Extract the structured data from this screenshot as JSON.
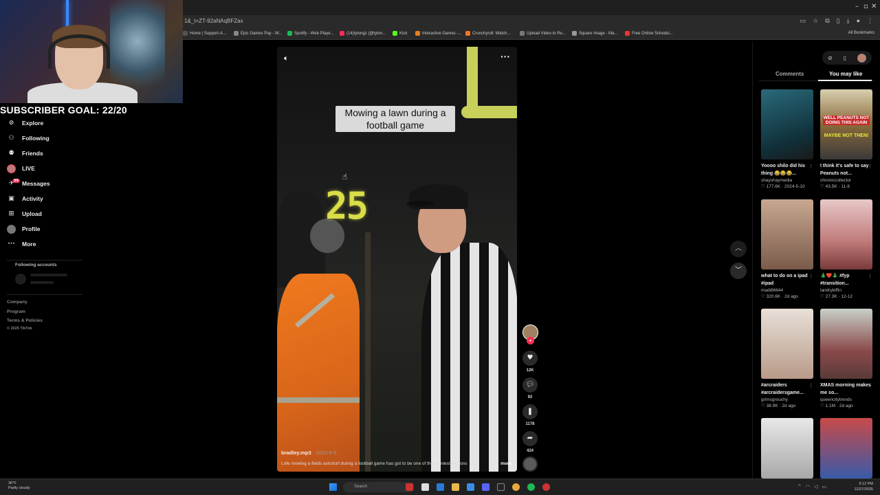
{
  "browser": {
    "url": "1&_t=ZT-92aNAqBFZax",
    "bookmarks": [
      {
        "label": "Home | Support-A...",
        "color": "#555"
      },
      {
        "label": "Epic Games Pay - W...",
        "color": "#888"
      },
      {
        "label": "Spotify - Web Playe...",
        "color": "#1db954"
      },
      {
        "label": "(14)tylongz (@tylon...",
        "color": "#fe2c55"
      },
      {
        "label": "Kick",
        "color": "#53fc18"
      },
      {
        "label": "Interactive Games -...",
        "color": "#e67e22"
      },
      {
        "label": "Crunchyroll: Watch...",
        "color": "#f47521"
      },
      {
        "label": "Upload Video to Re...",
        "color": "#777"
      },
      {
        "label": "Square Image - Ma...",
        "color": "#999"
      },
      {
        "label": "Free Online Schedul...",
        "color": "#e33"
      }
    ],
    "all_bookmarks": "All Bookmarks"
  },
  "overlay": {
    "subscriber_goal": "SUBSCRIBER GOAL: 22/20"
  },
  "nav": {
    "items": [
      {
        "label": "Explore",
        "icon": "compass-icon"
      },
      {
        "label": "Following",
        "icon": "person-icon"
      },
      {
        "label": "Friends",
        "icon": "friends-icon"
      },
      {
        "label": "LIVE",
        "icon": "live-avatar"
      },
      {
        "label": "Messages",
        "icon": "message-icon",
        "badge": "39"
      },
      {
        "label": "Activity",
        "icon": "inbox-icon"
      },
      {
        "label": "Upload",
        "icon": "plus-square-icon"
      },
      {
        "label": "Profile",
        "icon": "profile-avatar"
      },
      {
        "label": "More",
        "icon": "more-icon"
      }
    ],
    "following_accounts": "Following accounts",
    "footer": [
      "Company",
      "Program",
      "Terms & Policies",
      "© 2025 TikTok"
    ]
  },
  "video": {
    "caption": "Mowing a lawn during a football game",
    "clock_number": "25",
    "author": "bradley.mp3",
    "date": "· 2023-9-5",
    "description": "Lofe mowing a fields astroturf during a football game has got to be one of the funniest reasons",
    "more": "more"
  },
  "actions": {
    "likes": "12K",
    "comments": "92",
    "saves": "1178",
    "shares": "424"
  },
  "panel": {
    "tabs": [
      "Comments",
      "You may like"
    ],
    "active_tab": "You may like",
    "cards": [
      {
        "title": "Yoooo shilo did his thing 😂😂😂...",
        "user": "shayshaymedia",
        "likes": "177.6K",
        "date": "2024-5-10",
        "thumb_text": "",
        "bg": "linear-gradient(160deg,#2a6a7a,#10303a 70%,#1a1a1a)"
      },
      {
        "title": "I think it's safe to say Peanuts not...",
        "user": "chroniccollector",
        "likes": "43.5K",
        "date": "11-8",
        "thumb_text": "WELL PEANUTS NOT DOING THIS AGAIN",
        "thumb_text2": "MAYBE NOT THEN!",
        "bg": "linear-gradient(180deg,#d8d0b0,#8a6a3a 50%,#3a3a3a)"
      },
      {
        "title": "what to do on a ipad #ipad",
        "user": "madi86644",
        "likes": "320.6K",
        "date": "2d ago",
        "thumb_text": "",
        "bg": "linear-gradient(180deg,#c8a890,#7a5a4a)"
      },
      {
        "title": "🎄❤️🎄 #fyp #transition...",
        "user": "landrykiffin",
        "likes": "27.3K",
        "date": "12-12",
        "thumb_text": "",
        "bg": "linear-gradient(180deg,#e8c8c8,#c07a7a 60%,#7a3a3a)"
      },
      {
        "title": "#arcraiders #arcraidersgame...",
        "user": "grimsgrouchy",
        "likes": "38.9K",
        "date": "2d ago",
        "thumb_text": "",
        "bg": "linear-gradient(180deg,#e8e0d8,#b89a88)"
      },
      {
        "title": "XMAS morning makes me so...",
        "user": "queencitytrends",
        "likes": "1.1M",
        "date": "2d ago",
        "thumb_text": "",
        "bg": "linear-gradient(180deg,#c8d0c8,#8a4a4a 60%,#5a3a3a)"
      },
      {
        "title": "",
        "user": "",
        "likes": "",
        "date": "",
        "thumb_text": "",
        "bg": "linear-gradient(180deg,#e8e8e8,#a8a8a8)"
      },
      {
        "title": "",
        "user": "",
        "likes": "",
        "date": "",
        "thumb_text": "",
        "bg": "linear-gradient(180deg,#c84a4a,#3a5aa8)"
      }
    ]
  },
  "taskbar": {
    "weather_temp": "36°F",
    "weather_desc": "Partly cloudy",
    "search_placeholder": "Search",
    "time": "9:12 PM",
    "date": "12/27/2025"
  }
}
